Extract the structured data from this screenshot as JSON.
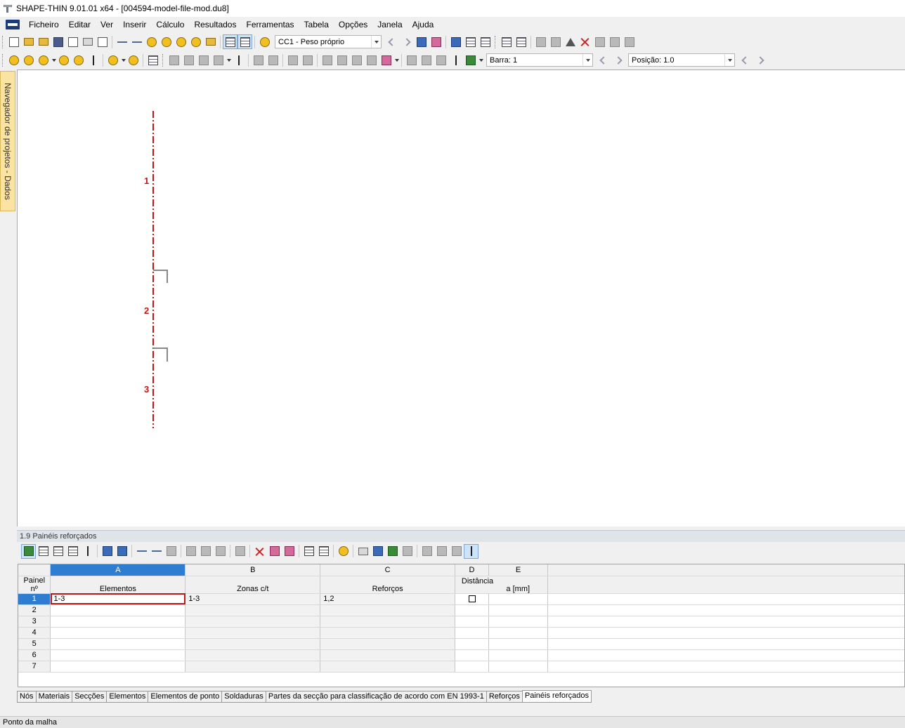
{
  "window": {
    "title": "SHAPE-THIN 9.01.01 x64  - [004594-model-file-mod.du8]"
  },
  "menu": [
    "Ficheiro",
    "Editar",
    "Ver",
    "Inserir",
    "Cálculo",
    "Resultados",
    "Ferramentas",
    "Tabela",
    "Opções",
    "Janela",
    "Ajuda"
  ],
  "toolbar": {
    "load_case": "CC1 - Peso próprio",
    "bar_label": "Barra: 1",
    "position_label": "Posição: 1.0"
  },
  "navigator": {
    "label": "Navegador de projetos - Dados"
  },
  "model": {
    "element_labels": [
      "1",
      "2",
      "3"
    ]
  },
  "panel": {
    "title": "1.9 Painéis reforçados",
    "columns": {
      "letters": [
        "A",
        "B",
        "C",
        "D",
        "E"
      ],
      "row_header_line1": "Painel",
      "row_header_line2": "nº",
      "elementos": "Elementos",
      "zonas": "Zonas c/t",
      "reforcos": "Reforços",
      "distancia": "Distância",
      "distancia_unit": "a [mm]"
    },
    "rows": [
      {
        "n": "1",
        "elementos": "1-3",
        "zonas": "1-3",
        "reforcos": "1,2"
      },
      {
        "n": "2",
        "elementos": "",
        "zonas": "",
        "reforcos": ""
      },
      {
        "n": "3",
        "elementos": "",
        "zonas": "",
        "reforcos": ""
      },
      {
        "n": "4",
        "elementos": "",
        "zonas": "",
        "reforcos": ""
      },
      {
        "n": "5",
        "elementos": "",
        "zonas": "",
        "reforcos": ""
      },
      {
        "n": "6",
        "elementos": "",
        "zonas": "",
        "reforcos": ""
      },
      {
        "n": "7",
        "elementos": "",
        "zonas": "",
        "reforcos": ""
      }
    ]
  },
  "sheets": [
    "Nós",
    "Materiais",
    "Secções",
    "Elementos",
    "Elementos de ponto",
    "Soldaduras",
    "Partes da secção para classificação de acordo com EN 1993-1",
    "Reforços",
    "Painéis reforçados"
  ],
  "active_sheet": "Painéis reforçados",
  "status": "Ponto da malha",
  "colors": {
    "selection": "#2f7dd1",
    "element": "#c01818",
    "navigator": "#fbe3a2"
  }
}
